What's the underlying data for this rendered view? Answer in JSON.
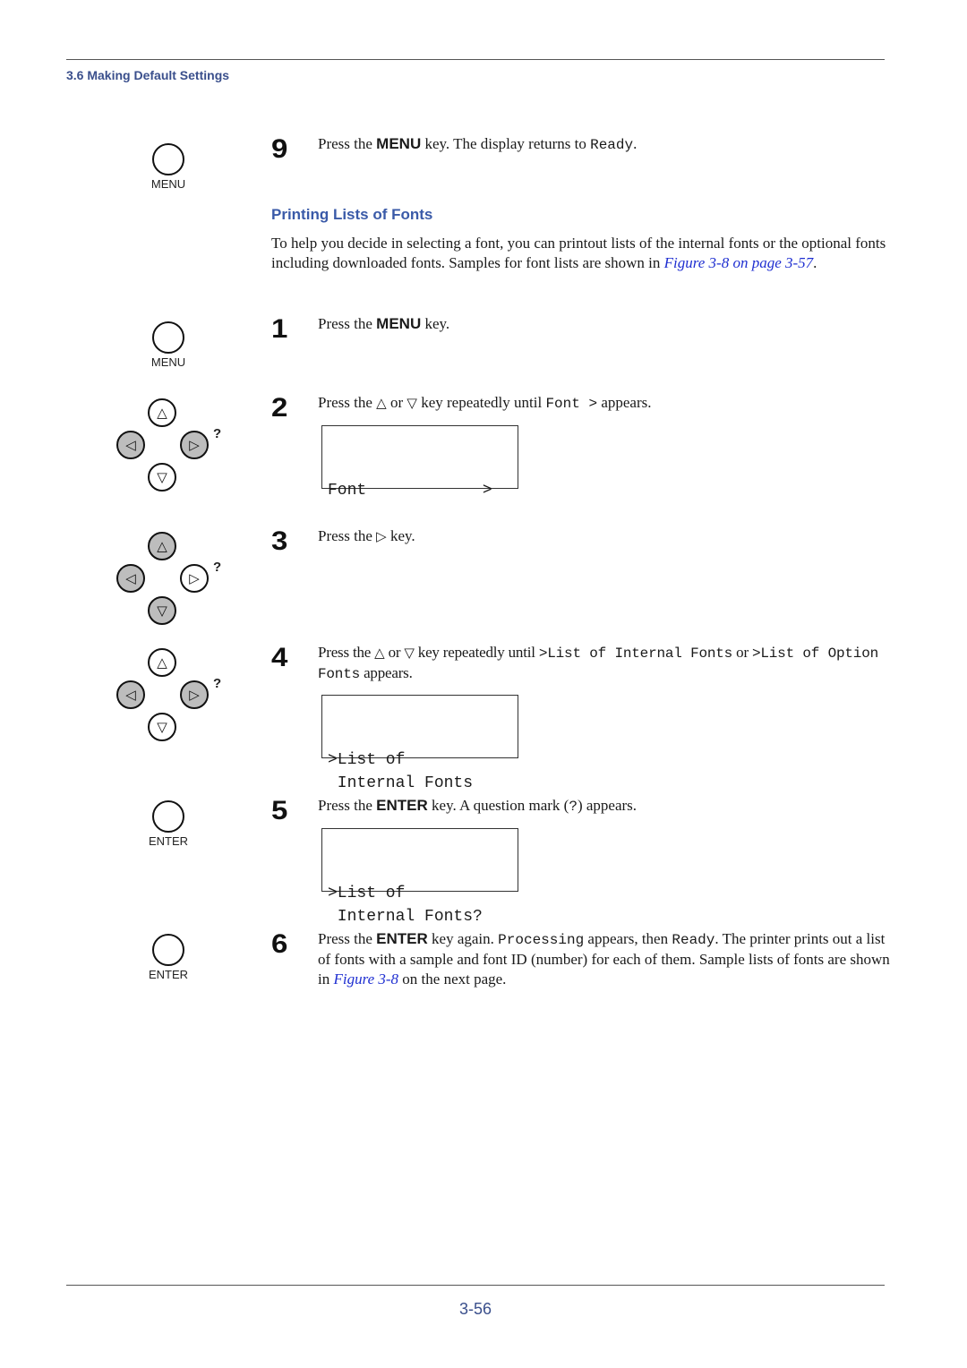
{
  "header": {
    "section": "3.6 Making Default Settings"
  },
  "footer": {
    "page_number": "3-56"
  },
  "icons": {
    "menu_label": "MENU",
    "enter_label": "ENTER",
    "up": "△",
    "down": "▽",
    "left": "◁",
    "right": "▷",
    "question": "?"
  },
  "step9": {
    "number": "9",
    "t1": "Press the ",
    "key": "MENU",
    "t2": " key. The display returns to ",
    "mono": "Ready",
    "t3": "."
  },
  "section": {
    "title": "Printing Lists of Fonts",
    "para_text": "To help you decide in selecting a font, you can printout lists of the internal fonts or the optional fonts including downloaded fonts. Samples for font lists are shown in ",
    "para_link": "Figure 3-8 on page 3-57",
    "para_end": "."
  },
  "steps": [
    {
      "number": "1",
      "t1": "Press the ",
      "key": "MENU",
      "t2": " key."
    },
    {
      "number": "2",
      "t1": "Press the ",
      "sym1": "△",
      "t2": " or ",
      "sym2": "▽",
      "t3": " key repeatedly until ",
      "mono": "Font >",
      "t4": " appears.",
      "lcd": [
        "Font            >",
        ""
      ]
    },
    {
      "number": "3",
      "t1": "Press the ",
      "sym1": "▷",
      "t2": " key."
    },
    {
      "number": "4",
      "t1": "Press the ",
      "sym1": "△",
      "t2": " or ",
      "sym2": "▽",
      "t3": " key repeatedly until ",
      "mono1": ">List of Internal Fonts",
      "t4": " or ",
      "mono2": ">List of Option Fonts",
      "t5": " appears.",
      "lcd": [
        ">List of",
        " Internal Fonts"
      ]
    },
    {
      "number": "5",
      "t1": "Press the ",
      "key": "ENTER",
      "t2": " key. A question mark (",
      "mono": "?",
      "t3": ") appears.",
      "lcd": [
        ">List of",
        " Internal Fonts?"
      ]
    },
    {
      "number": "6",
      "t1": "Press the ",
      "key": "ENTER",
      "t2": " key again. ",
      "mono1": "Processing",
      "t3": " appears, then ",
      "mono2": "Ready",
      "t4": ". The printer prints out a list of fonts with a sample and font ID (number) for each of them. Sample lists of fonts are shown in ",
      "link": "Figure 3-8",
      "t5": " on the next page."
    }
  ]
}
